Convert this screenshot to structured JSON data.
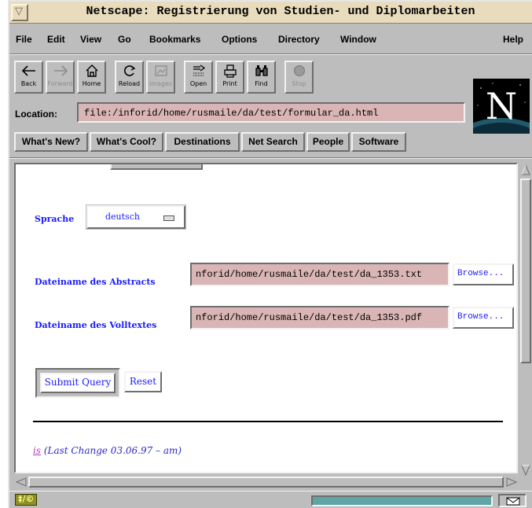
{
  "window": {
    "title": "Netscape: Registrierung von Studien- und Diplomarbeiten",
    "title_menu_glyph": "▽"
  },
  "menu": {
    "file": "File",
    "edit": "Edit",
    "view": "View",
    "go": "Go",
    "bookmarks": "Bookmarks",
    "options": "Options",
    "directory": "Directory",
    "window": "Window",
    "help": "Help"
  },
  "toolbar": {
    "back": "Back",
    "forward": "Forward",
    "home": "Home",
    "reload": "Reload",
    "images": "Images",
    "open": "Open",
    "print": "Print",
    "find": "Find",
    "stop": "Stop"
  },
  "location": {
    "label": "Location:",
    "url": "file:/inforid/home/rusmaile/da/test/formular_da.html"
  },
  "directory_buttons": {
    "whats_new": "What's New?",
    "whats_cool": "What's Cool?",
    "destinations": "Destinations",
    "net_search": "Net Search",
    "people": "People",
    "software": "Software"
  },
  "form": {
    "sprache_label": "Sprache",
    "sprache_value": "deutsch",
    "abstract_label": "Dateiname des Abstracts",
    "abstract_value": "nforid/home/rusmaile/da/test/da_1353.txt",
    "volltext_label": "Dateiname des Volltextes",
    "volltext_value": "nforid/home/rusmaile/da/test/da_1353.pdf",
    "browse_label": "Browse...",
    "submit_label": "Submit Query",
    "reset_label": "Reset"
  },
  "footer": {
    "link_text": "is",
    "change_text": " (Last Change 03.06.97 – am)"
  },
  "status": {
    "security_text": "‡/©"
  },
  "colors": {
    "title_bar": "#e8dcbc",
    "chrome": "#bdbdbd",
    "field_bg": "#d9b5b5",
    "form_text": "#1a1aff",
    "link_visited": "#b63fb6",
    "progress": "#60a5a5"
  }
}
